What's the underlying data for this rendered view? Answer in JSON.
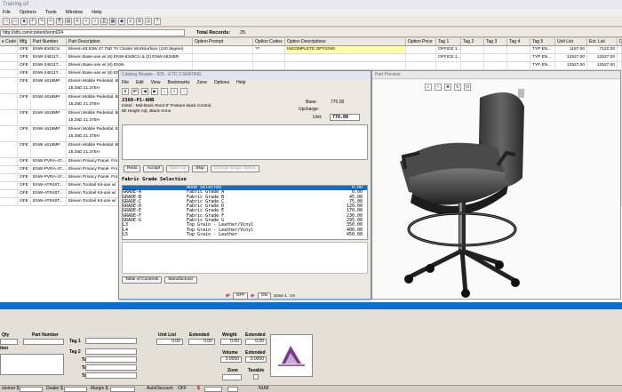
{
  "app": {
    "title": "Training.sif",
    "menu": [
      "File",
      "Options",
      "Tools",
      "Window",
      "Help"
    ],
    "address": "http://sifs.com/content/enm024",
    "total_records_label": "Total Records:",
    "total_records_value": "25"
  },
  "grid": {
    "headers": [
      "e Code",
      "Mfg",
      "Part Number",
      "Part Description",
      "Option Prompt",
      "Option Codes",
      "Option Descriptions",
      "Option Price",
      "Tag 1",
      "Tag 2",
      "Tag 3",
      "Tag 4",
      "Tag 5",
      "Unit List",
      "Ext. List",
      "D"
    ],
    "rows": [
      {
        "c0": "",
        "mfg": "OFE",
        "pn": "ENW-8345CU",
        "desc": "Eleven 83.53W 47.75D Tri Cluster Worksurface (120 degree)",
        "desc2": "",
        "oc": "??",
        "od": "INCOMPLETE OPTIONS",
        "t1": "OFFICE 1...",
        "t5": "TYP EN...",
        "ul": "1187.00",
        "el": "7122.00",
        "yellow": true
      },
      {
        "c0": "",
        "mfg": "OFE",
        "pn": "ENW-24811T...",
        "desc": "Eleven Base-use w/ (6) ENW-8345CU & (2) ENW-4834BR",
        "desc2": "",
        "oc": "",
        "od": "",
        "t1": "OFFICE 1...",
        "t5": "TYP EN...",
        "ul": "12527.00",
        "el": "12527.00",
        "yellow": false
      },
      {
        "c0": "",
        "mfg": "OFE",
        "pn": "ENW-24811T...",
        "desc": "Eleven Base-use w/ (6) ENW-",
        "desc2": "",
        "oc": "",
        "od": "",
        "t1": "",
        "t5": "TYP EN...",
        "ul": "12527.00",
        "el": "12527.00",
        "yellow": false
      },
      {
        "c0": "",
        "mfg": "OFE",
        "pn": "ENW-24811T...",
        "desc": "Eleven Base-use w/ (6) ENW-",
        "desc2": "",
        "oc": "",
        "od": "",
        "t1": "",
        "t5": "TYP EN...",
        "ul": "12527.00",
        "el": "12527.00",
        "yellow": false
      },
      {
        "c0": "",
        "mfg": "OFE",
        "pn": "ENW-1619MP",
        "desc": "Eleven Mobile Pedestal, B",
        "desc2": "15.25D 21.375H",
        "oc": "",
        "od": "",
        "t1": "",
        "t5": "TYP EN...",
        "ul": "723.00",
        "el": "4338.00",
        "yellow": false
      },
      {
        "c0": "",
        "mfg": "OFE",
        "pn": "ENW-1619MP",
        "desc": "Eleven Mobile Pedestal, B",
        "desc2": "15.25D 21.375H",
        "oc": "",
        "od": "",
        "t1": "",
        "t5": "TYP EN...",
        "ul": "723.00",
        "el": "4338.00",
        "yellow": false
      },
      {
        "c0": "",
        "mfg": "OFE",
        "pn": "ENW-1619MP",
        "desc": "Eleven Mobile Pedestal, B",
        "desc2": "15.25D 21.375H",
        "oc": "",
        "od": "",
        "t1": "",
        "t5": "",
        "ul": "1260.00",
        "el": "7560.00",
        "yellow": false
      },
      {
        "c0": "",
        "mfg": "OFE",
        "pn": "ENW-1619MP",
        "desc": "Eleven Mobile Pedestal, E",
        "desc2": "15.25D 21.375H",
        "oc": "",
        "od": "",
        "t1": "",
        "t5": "TYP EN...",
        "ul": "723.00",
        "el": "4338.00",
        "yellow": false
      },
      {
        "c0": "",
        "mfg": "OFE",
        "pn": "ENW-1619MP",
        "desc": "Eleven Mobile Pedestal, B",
        "desc2": "15.25D 21.375H",
        "oc": "",
        "od": "",
        "t1": "",
        "t5": "TYP EN...",
        "ul": "790.00",
        "el": "4740.00",
        "yellow": false
      },
      {
        "c0": "",
        "mfg": "OFE",
        "pn": "ENW-PVRA-47...",
        "desc": "Eleven Privacy Panel- Fro",
        "desc2": "",
        "oc": "",
        "od": "",
        "t1": "",
        "t5": "TYP EN...",
        "ul": "348.00",
        "el": "2436.00",
        "yellow": false
      },
      {
        "c0": "",
        "mfg": "OFE",
        "pn": "ENW-PVRA-47...",
        "desc": "Eleven Privacy Panel- Fro",
        "desc2": "",
        "oc": "",
        "od": "",
        "t1": "",
        "t5": "TYP EN...",
        "ul": "348.00",
        "el": "2436.00",
        "yellow": false
      },
      {
        "c0": "",
        "mfg": "OFE",
        "pn": "ENW-PVRA-47...",
        "desc": "Eleven Privacy Panel- Fro",
        "desc2": "",
        "oc": "",
        "od": "",
        "t1": "",
        "t5": "TYP EN...",
        "ul": "348.00",
        "el": "2436.00",
        "yellow": false
      },
      {
        "c0": "",
        "mfg": "OFE",
        "pn": "ENW-ATR40T...",
        "desc": "Eleven Toolrail Kit-use w/",
        "desc2": "",
        "oc": "",
        "od": "",
        "t1": "",
        "t5": "TYP EN...",
        "ul": "3201.00",
        "el": "3201.00",
        "yellow": false
      },
      {
        "c0": "",
        "mfg": "OFE",
        "pn": "ENW-ATR40T...",
        "desc": "Eleven Toolrail Kit-use w/",
        "desc2": "",
        "oc": "",
        "od": "",
        "t1": "",
        "t5": "TYP EN...",
        "ul": "3201.00",
        "el": "3201.00",
        "yellow": false
      },
      {
        "c0": "",
        "mfg": "OFE",
        "pn": "ENW-ATR40T...",
        "desc": "Eleven Toolrail Kit-use w/",
        "desc2": "",
        "oc": "",
        "od": "",
        "t1": "",
        "t5": "TYP EN...",
        "ul": "3201.00",
        "el": "3201.00",
        "yellow": false
      }
    ]
  },
  "catalog": {
    "title": "Catalog Reader - 825 - ETO 3 SEATING",
    "menu": [
      "File",
      "Edit",
      "View",
      "Bookmarks",
      "Zone",
      "Options",
      "Help"
    ],
    "part_number": "2368-P1-AHB",
    "desc_lines": [
      "Instol - Mid-Back Stool 8\" Posture Back Control,",
      "80 Height Adj. Black Arms"
    ],
    "base_label": "Base:",
    "base_value": "770.00",
    "upcharge_label": "Upcharge:",
    "upcharge_value": "",
    "unit_label": "Unit:",
    "unit_value": "770.00",
    "buttons": [
      "Redo",
      "Accept",
      "Back Up",
      "Skip",
      "Change Single Option"
    ],
    "disabled_buttons": [
      "Back Up",
      "Change Single Option"
    ],
    "option_title": "Fabric Grade Selection",
    "options": [
      {
        "code": "",
        "desc": "None Selected",
        "price": "0.00",
        "sel": true
      },
      {
        "code": "GRADE-A",
        "desc": "Fabric Grade A",
        "price": "0.00",
        "sel": false
      },
      {
        "code": "GRADE-B",
        "desc": "Fabric Grade B",
        "price": "45.00",
        "sel": false
      },
      {
        "code": "GRADE-C",
        "desc": "Fabric Grade C",
        "price": "75.00",
        "sel": false
      },
      {
        "code": "GRADE-D",
        "desc": "Fabric Grade D",
        "price": "120.00",
        "sel": false
      },
      {
        "code": "GRADE-E",
        "desc": "Fabric Grade E",
        "price": "170.00",
        "sel": false
      },
      {
        "code": "GRADE-F",
        "desc": "Fabric Grade F",
        "price": "230.00",
        "sel": false
      },
      {
        "code": "GRADE-G",
        "desc": "Fabric Grade G",
        "price": "295.00",
        "sel": false
      },
      {
        "code": "L3",
        "desc": "Top Grain - Leather/Vinyl",
        "price": "350.00",
        "sel": false
      },
      {
        "code": "L4",
        "desc": "Top Grain - Leather/Vinyl",
        "price": "400.00",
        "sel": false
      },
      {
        "code": "L5",
        "desc": "Top Grain - Leather",
        "price": "450.00",
        "sel": false
      }
    ],
    "footer_buttons": [
      "Table of Contents",
      "Manufacturer"
    ],
    "status": {
      "off": "OFF",
      "on": "ON",
      "zone": "Zone 1",
      "zone_num": "V4"
    }
  },
  "preview": {
    "title": "Part Preview"
  },
  "bottom": {
    "qty_label": "Qty",
    "part_number_label": "Part Number",
    "tion_label": "tion",
    "tags": [
      "Tag 1",
      "Tag 2",
      "Tag 3",
      "Tag 4",
      "Tag 5"
    ],
    "unit_list_label": "Unit List",
    "extended_label": "Extended",
    "weight_label": "Weight",
    "extended2_label": "Extended",
    "unit_list_value": "0.00",
    "extended_value": "0.00",
    "weight_value": "0.00",
    "extended2_value": "0.00",
    "volume_label": "Volume",
    "volume_value": "0.0000",
    "volume_ext_label": "Extended",
    "volume_ext_value": "0.0000",
    "zone_label": "Zone",
    "taxable_label": "Taxable"
  },
  "status_bar": {
    "customer": "stomer $",
    "dealer": "Dealer $",
    "margin": "Margin $",
    "autodiscount": "AutoDiscount",
    "off": "OFF",
    "num": "NUM"
  }
}
